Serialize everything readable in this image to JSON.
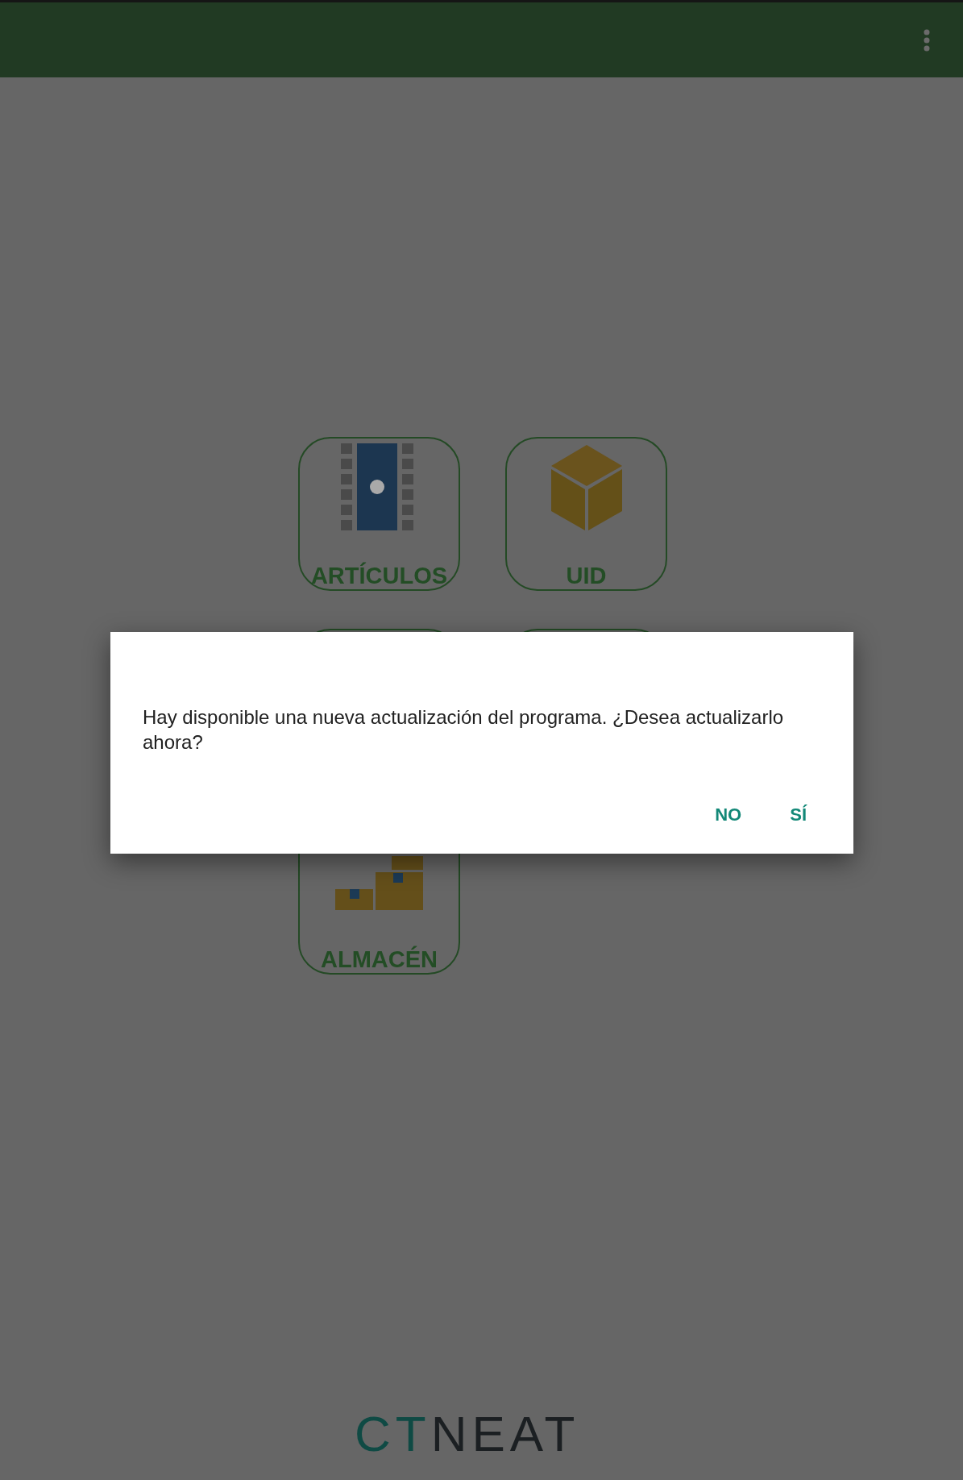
{
  "tiles": [
    {
      "kind": "film",
      "label": "ARTÍCULOS"
    },
    {
      "kind": "cube",
      "label": "UID"
    },
    {
      "kind": "blank"
    },
    {
      "kind": "blank"
    },
    {
      "kind": "boxes",
      "label": "ALMACÉN"
    }
  ],
  "dialog": {
    "message": "Hay disponible una nueva actualización del programa. ¿Desea actualizarlo ahora?",
    "buttons": [
      "NO",
      "SÍ"
    ]
  },
  "logo": {
    "prefix": "CT",
    "suffix": "NEAT"
  }
}
